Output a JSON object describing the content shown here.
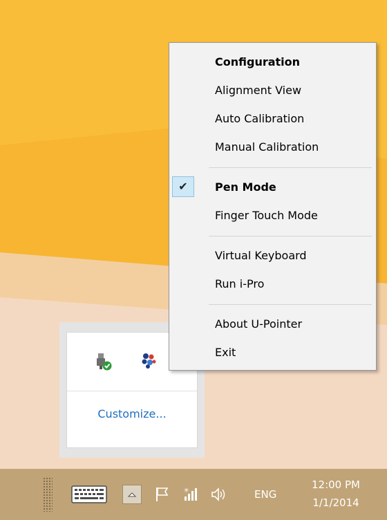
{
  "context_menu": {
    "items": [
      {
        "label": "Configuration",
        "bold": true
      },
      {
        "label": "Alignment View"
      },
      {
        "label": "Auto Calibration"
      },
      {
        "label": "Manual Calibration"
      },
      {
        "label": "Pen Mode",
        "bold": true,
        "checked": true
      },
      {
        "label": "Finger Touch Mode"
      },
      {
        "label": "Virtual Keyboard"
      },
      {
        "label": "Run i-Pro"
      },
      {
        "label": "About U-Pointer"
      },
      {
        "label": "Exit"
      }
    ]
  },
  "tray_popup": {
    "icons": [
      "usb-device-ok-icon",
      "u-pointer-app-icon"
    ],
    "customize_label": "Customize..."
  },
  "taskbar": {
    "icons": [
      "touch-keyboard-icon",
      "show-hidden-icons-chevron",
      "action-center-flag-icon",
      "network-signal-icon",
      "volume-icon"
    ],
    "language": "ENG",
    "time": "12:00 PM",
    "date": "1/1/2014"
  },
  "colors": {
    "desktop_orange": "#f7b531",
    "desktop_peach": "#f4d9c2",
    "taskbar": "#c0a477",
    "menu_background": "#f2f2f2",
    "check_highlight": "#cde8f7",
    "link_blue": "#1e6fc2"
  }
}
